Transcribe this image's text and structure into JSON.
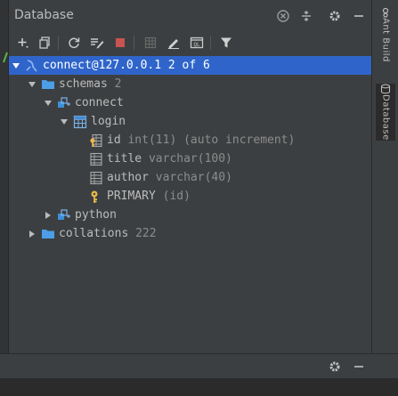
{
  "panel": {
    "title": "Database"
  },
  "toolbar": {
    "items": [
      "add",
      "copy",
      "refresh",
      "edit-schema",
      "stop",
      "table-view",
      "edit",
      "console",
      "filter"
    ]
  },
  "tree": {
    "rows": [
      {
        "name": "connect@127.0.0.1",
        "detail": "2 of 6",
        "depth": 0,
        "expanded": true,
        "selected": true,
        "icon": "datasource-icon"
      },
      {
        "name": "schemas",
        "detail": "2",
        "depth": 1,
        "expanded": true,
        "icon": "folder-icon"
      },
      {
        "name": "connect",
        "detail": "",
        "depth": 2,
        "expanded": true,
        "icon": "schema-icon"
      },
      {
        "name": "login",
        "detail": "",
        "depth": 3,
        "expanded": true,
        "icon": "table-icon"
      },
      {
        "name": "id",
        "detail": "int(11) (auto increment)",
        "depth": 4,
        "icon": "key-column-icon"
      },
      {
        "name": "title",
        "detail": "varchar(100)",
        "depth": 4,
        "icon": "column-icon"
      },
      {
        "name": "author",
        "detail": "varchar(40)",
        "depth": 4,
        "icon": "column-icon"
      },
      {
        "name": "PRIMARY",
        "detail": "(id)",
        "depth": 4,
        "icon": "key-icon"
      },
      {
        "name": "python",
        "detail": "",
        "depth": 2,
        "expanded": false,
        "icon": "schema-icon"
      },
      {
        "name": "collations",
        "detail": "222",
        "depth": 1,
        "expanded": false,
        "icon": "folder-icon"
      }
    ]
  },
  "sidebar_tabs": {
    "top": "Ant Build",
    "bottom": "Database"
  },
  "colors": {
    "selection": "#2f65ca",
    "folder": "#4d9ee8",
    "stop": "#c75450",
    "key": "#e8b84b"
  }
}
